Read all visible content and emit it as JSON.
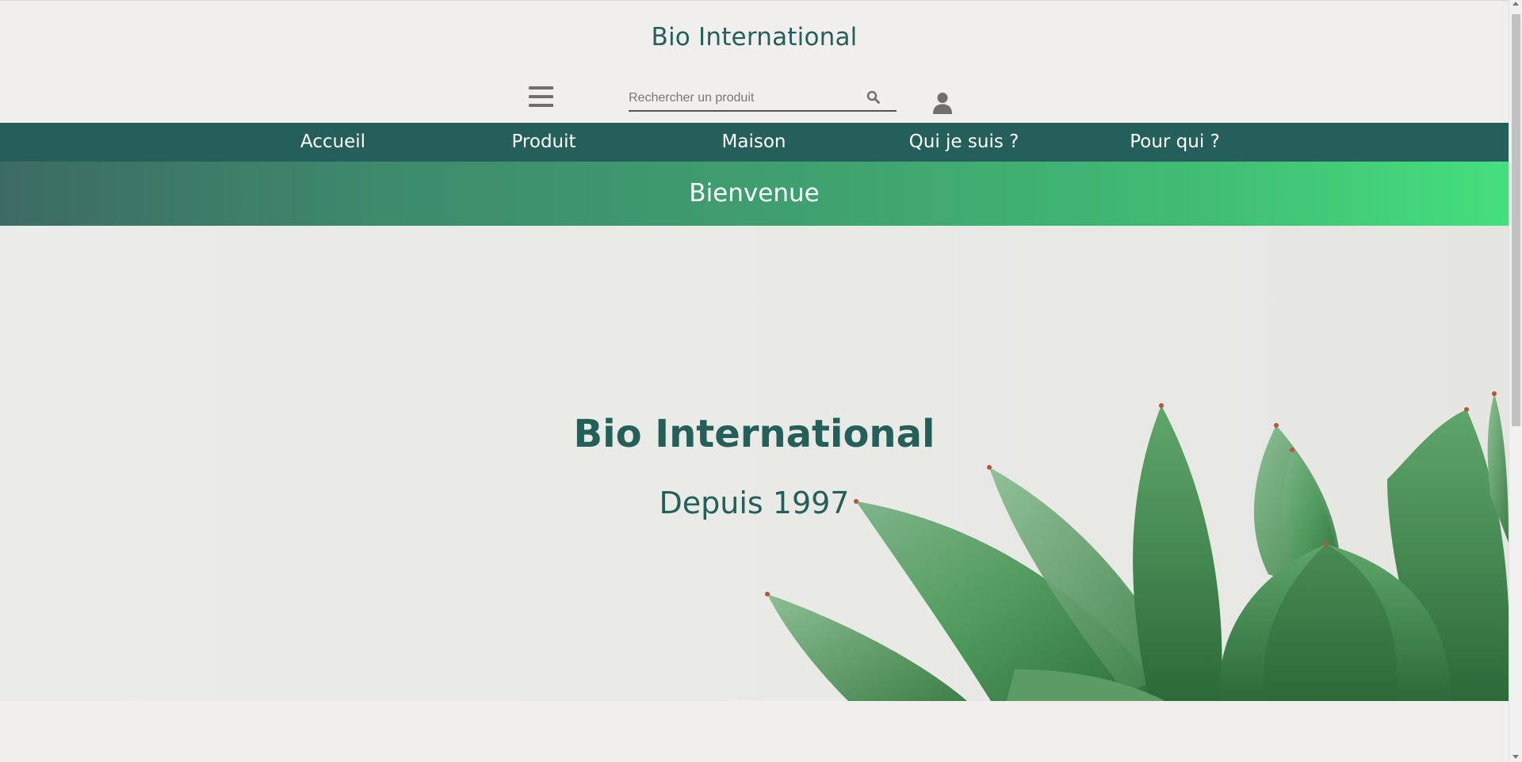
{
  "header": {
    "brand": "Bio International"
  },
  "search": {
    "placeholder": "Rechercher un produit"
  },
  "nav": {
    "items": [
      {
        "label": "Accueil"
      },
      {
        "label": "Produit"
      },
      {
        "label": "Maison"
      },
      {
        "label": "Qui je suis ?"
      },
      {
        "label": "Pour qui ?"
      }
    ]
  },
  "banner": {
    "title": "Bienvenue"
  },
  "hero": {
    "title": "Bio International",
    "subtitle": "Depuis 1997"
  },
  "icons": {
    "menu": "hamburger-menu-icon",
    "search": "search-icon",
    "user": "user-icon"
  },
  "colors": {
    "brand": "#255f5a",
    "nav_bg": "#245f5a",
    "banner_start": "#3d6b63",
    "banner_end": "#45df7e",
    "page_bg": "#f0efee"
  }
}
